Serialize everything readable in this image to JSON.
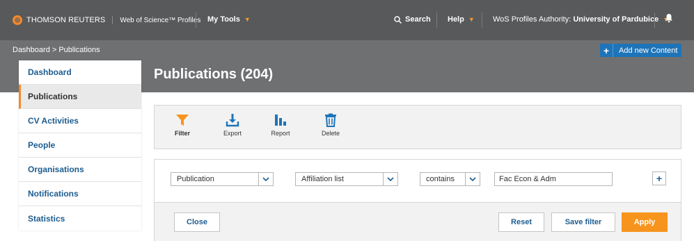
{
  "topbar": {
    "brand": "THOMSON REUTERS",
    "product": "Web of Science™ Profiles",
    "my_tools": "My Tools",
    "search": "Search",
    "help": "Help",
    "authority_label": "WoS Profiles Authority: ",
    "authority_value": "University of Pardubice"
  },
  "breadcrumb": "Dashboard > Publications",
  "add_button": {
    "plus": "+",
    "label": "Add new Content"
  },
  "page_title": "Publications (204)",
  "sidebar": {
    "items": [
      {
        "label": "Dashboard"
      },
      {
        "label": "Publications"
      },
      {
        "label": "CV Activities"
      },
      {
        "label": "People"
      },
      {
        "label": "Organisations"
      },
      {
        "label": "Notifications"
      },
      {
        "label": "Statistics"
      }
    ]
  },
  "toolbar": {
    "filter": "Filter",
    "export": "Export",
    "report": "Report",
    "delete": "Delete"
  },
  "filter": {
    "field": "Publication",
    "attribute": "Affiliation list",
    "operator": "contains",
    "value": "Fac Econ & Adm",
    "add": "+",
    "close": "Close",
    "reset": "Reset",
    "save": "Save filter",
    "apply": "Apply"
  },
  "colors": {
    "topbar": "#58595b",
    "band": "#6f7072",
    "accent": "#f7941d",
    "primary": "#1e74b8",
    "link": "#1d5c8f"
  },
  "icons": [
    "logo-icon",
    "search-icon",
    "bell-icon",
    "filter-icon",
    "export-icon",
    "report-icon",
    "delete-icon",
    "chevron-down-icon"
  ]
}
